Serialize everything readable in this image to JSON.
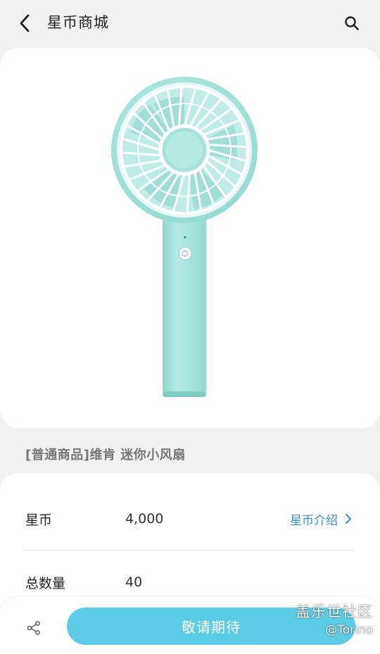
{
  "header": {
    "title": "星币商城",
    "back_icon": "chevron-left-icon",
    "search_icon": "search-icon"
  },
  "product": {
    "image_subject": "handheld-fan",
    "image_color": "#a9e6de",
    "name": "[普通商品]维肯 迷你小风扇"
  },
  "info": {
    "coin_label": "星币",
    "coin_value": "4,000",
    "coin_intro_label": "星币介绍",
    "quantity_label": "总数量",
    "quantity_value": "40"
  },
  "bottom_bar": {
    "share_icon": "share-icon",
    "action_label": "敬请期待",
    "action_color": "#5ccbe6"
  },
  "watermark": {
    "line1": "盖乐世社区",
    "line2": "@Torino"
  }
}
